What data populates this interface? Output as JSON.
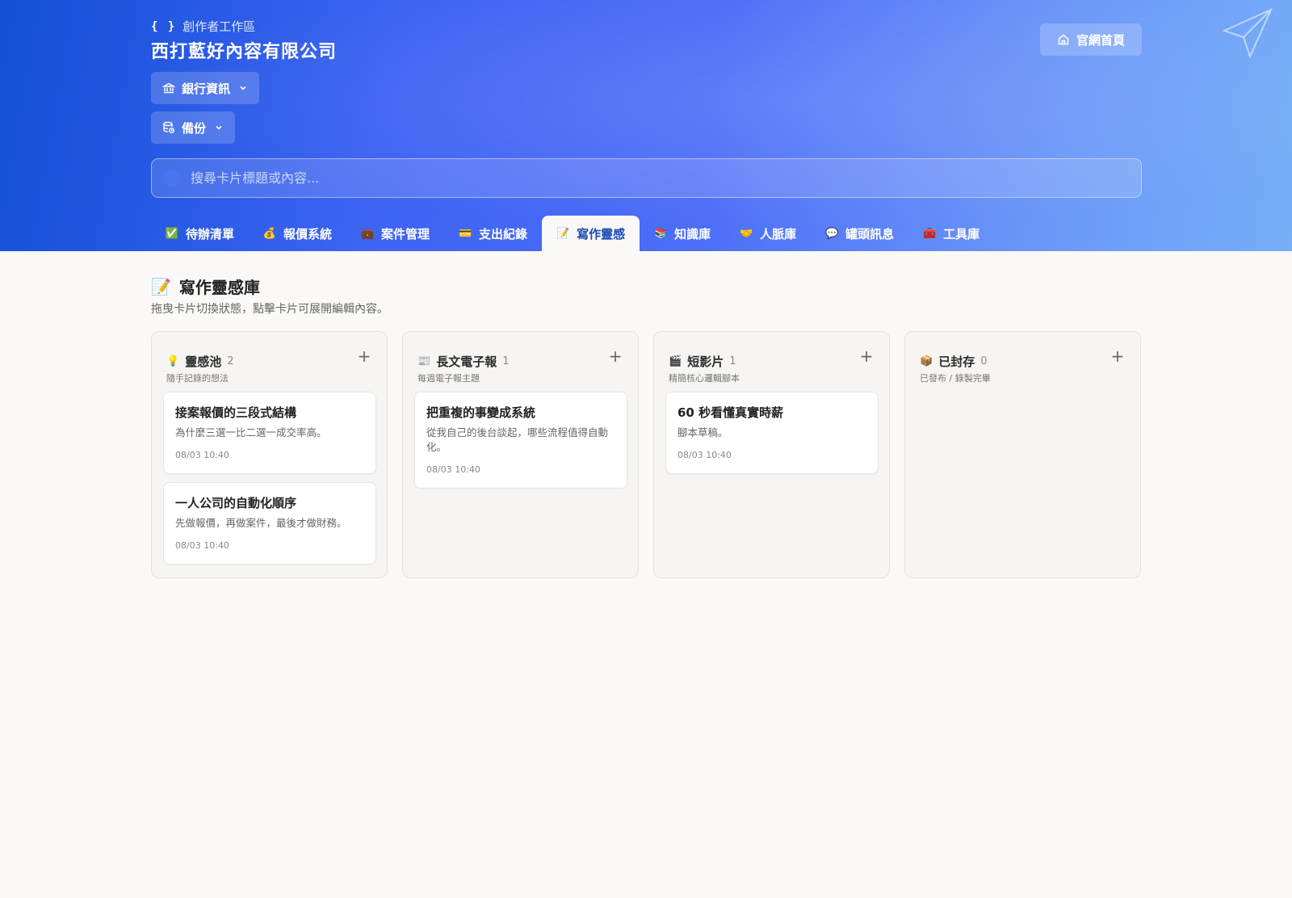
{
  "header": {
    "workspace_label": "創作者工作區",
    "brace_glyph": "{ }",
    "company_name": "西打藍好內容有限公司",
    "bank_label": "銀行資訊",
    "backup_label": "備份",
    "home_label": "官網首頁"
  },
  "search": {
    "placeholder": "搜尋卡片標題或內容..."
  },
  "tabs": [
    {
      "label": "待辦清單",
      "icon": "✅",
      "icon_name": "check-box-icon"
    },
    {
      "label": "報價系統",
      "icon": "💰",
      "icon_name": "money-bag-icon"
    },
    {
      "label": "案件管理",
      "icon": "💼",
      "icon_name": "briefcase-icon"
    },
    {
      "label": "支出紀錄",
      "icon": "💳",
      "icon_name": "credit-card-icon"
    },
    {
      "label": "寫作靈感",
      "icon": "📝",
      "icon_name": "memo-icon",
      "active": true
    },
    {
      "label": "知識庫",
      "icon": "📚",
      "icon_name": "books-icon"
    },
    {
      "label": "人脈庫",
      "icon": "🤝",
      "icon_name": "handshake-icon"
    },
    {
      "label": "罐頭訊息",
      "icon": "💬",
      "icon_name": "speech-bubble-icon"
    },
    {
      "label": "工具庫",
      "icon": "🧰",
      "icon_name": "toolbox-icon"
    }
  ],
  "section": {
    "icon": "📝",
    "title": "寫作靈感庫",
    "subtitle": "拖曳卡片切換狀態，點擊卡片可展開編輯內容。"
  },
  "columns": [
    {
      "icon": "💡",
      "icon_name": "lightbulb-icon",
      "title": "靈感池",
      "count": "2",
      "desc": "隨手記錄的想法",
      "cards": [
        {
          "title": "接案報價的三段式結構",
          "body": "為什麼三選一比二選一成交率高。",
          "time": "08/03 10:40"
        },
        {
          "title": "一人公司的自動化順序",
          "body": "先做報價，再做案件，最後才做財務。",
          "time": "08/03 10:40"
        }
      ]
    },
    {
      "icon": "📰",
      "icon_name": "newspaper-icon",
      "title": "長文電子報",
      "count": "1",
      "desc": "每週電子報主題",
      "cards": [
        {
          "title": "把重複的事變成系統",
          "body": "從我自己的後台談起，哪些流程值得自動化。",
          "time": "08/03 10:40"
        }
      ]
    },
    {
      "icon": "🎬",
      "icon_name": "clapper-board-icon",
      "title": "短影片",
      "count": "1",
      "desc": "精簡核心邏輯腳本",
      "cards": [
        {
          "title": "60 秒看懂真實時薪",
          "body": "腳本草稿。",
          "time": "08/03 10:40"
        }
      ]
    },
    {
      "icon": "📦",
      "icon_name": "package-icon",
      "title": "已封存",
      "count": "0",
      "desc": "已發布 / 錄製完畢",
      "cards": []
    }
  ],
  "add_glyph": "+"
}
